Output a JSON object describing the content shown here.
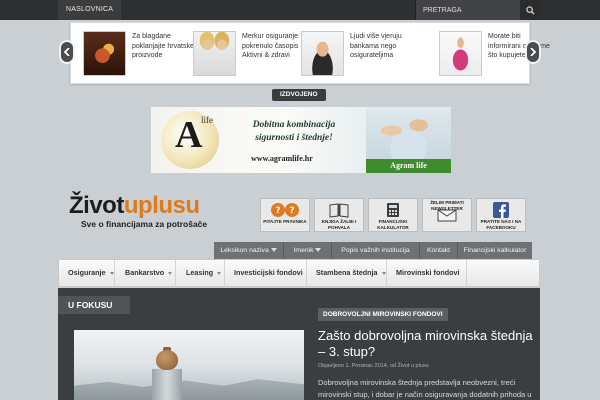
{
  "topbar": {
    "home_label": "NASLOVNICA",
    "search_placeholder": "PRETRAGA"
  },
  "featured": {
    "tab_label": "IZDVOJENO",
    "items": [
      {
        "text": "Za blagdane poklanjajte hrvatske proizvode"
      },
      {
        "text": "Merkur osiguranje pokrenulo časopis Aktivni & zdravi"
      },
      {
        "text": "Ljudi više vjeruju bankama nego osigurateljima"
      },
      {
        "text": "Morate biti informirani o onome što kupujete"
      }
    ]
  },
  "banner": {
    "logo_letter": "A",
    "logo_word": "life",
    "slogan": "Dobitna kombinacija sigurnosti i štednje!",
    "url": "www.agramlife.hr",
    "brand": "Agram life"
  },
  "logo": {
    "part1": "Život",
    "part2": "uplusu",
    "tagline": "Sve o financijama za potrošače"
  },
  "quick_links": [
    {
      "label": "PITAJTE PRAVNIKA"
    },
    {
      "label": "KNJIGA ŽALBI I POHVALA"
    },
    {
      "label": "FINANCIJSKI KALKULATOR"
    },
    {
      "label": "ŽELIM PRIMATI NEWSLETTER"
    },
    {
      "label": "PRATITE NAS I NA FACEBOOKU"
    }
  ],
  "subnav": [
    "Leksikon naziva",
    "Imenik",
    "Popis važnih institucija",
    "Kontakt",
    "Financijski kalkulator"
  ],
  "mainnav": [
    "Osiguranje",
    "Bankarstvo",
    "Leasing",
    "Investicijski fondovi",
    "Stambena štednja",
    "Mirovinski fondovi"
  ],
  "content": {
    "section_label": "U FOKUSU",
    "category": "DOBROVOLJNI MIROVINSKI FONDOVI",
    "headline": "Zašto dobrovoljna mirovinska štednja – 3. stup?",
    "meta": "Objavljeno 1. Prosinac 2014. od Život u plusu",
    "excerpt": "Dobrovoljna mirovinska štednja predstavlja neobvezni, treći mirovinski stup, i dobar je način osiguravanja dodatnih prihoda u"
  },
  "colors": {
    "accent_orange": "#e07a1f",
    "dark": "#2d2f31",
    "content_bg": "#3b3e41",
    "page_bg": "#c9cfd3"
  }
}
